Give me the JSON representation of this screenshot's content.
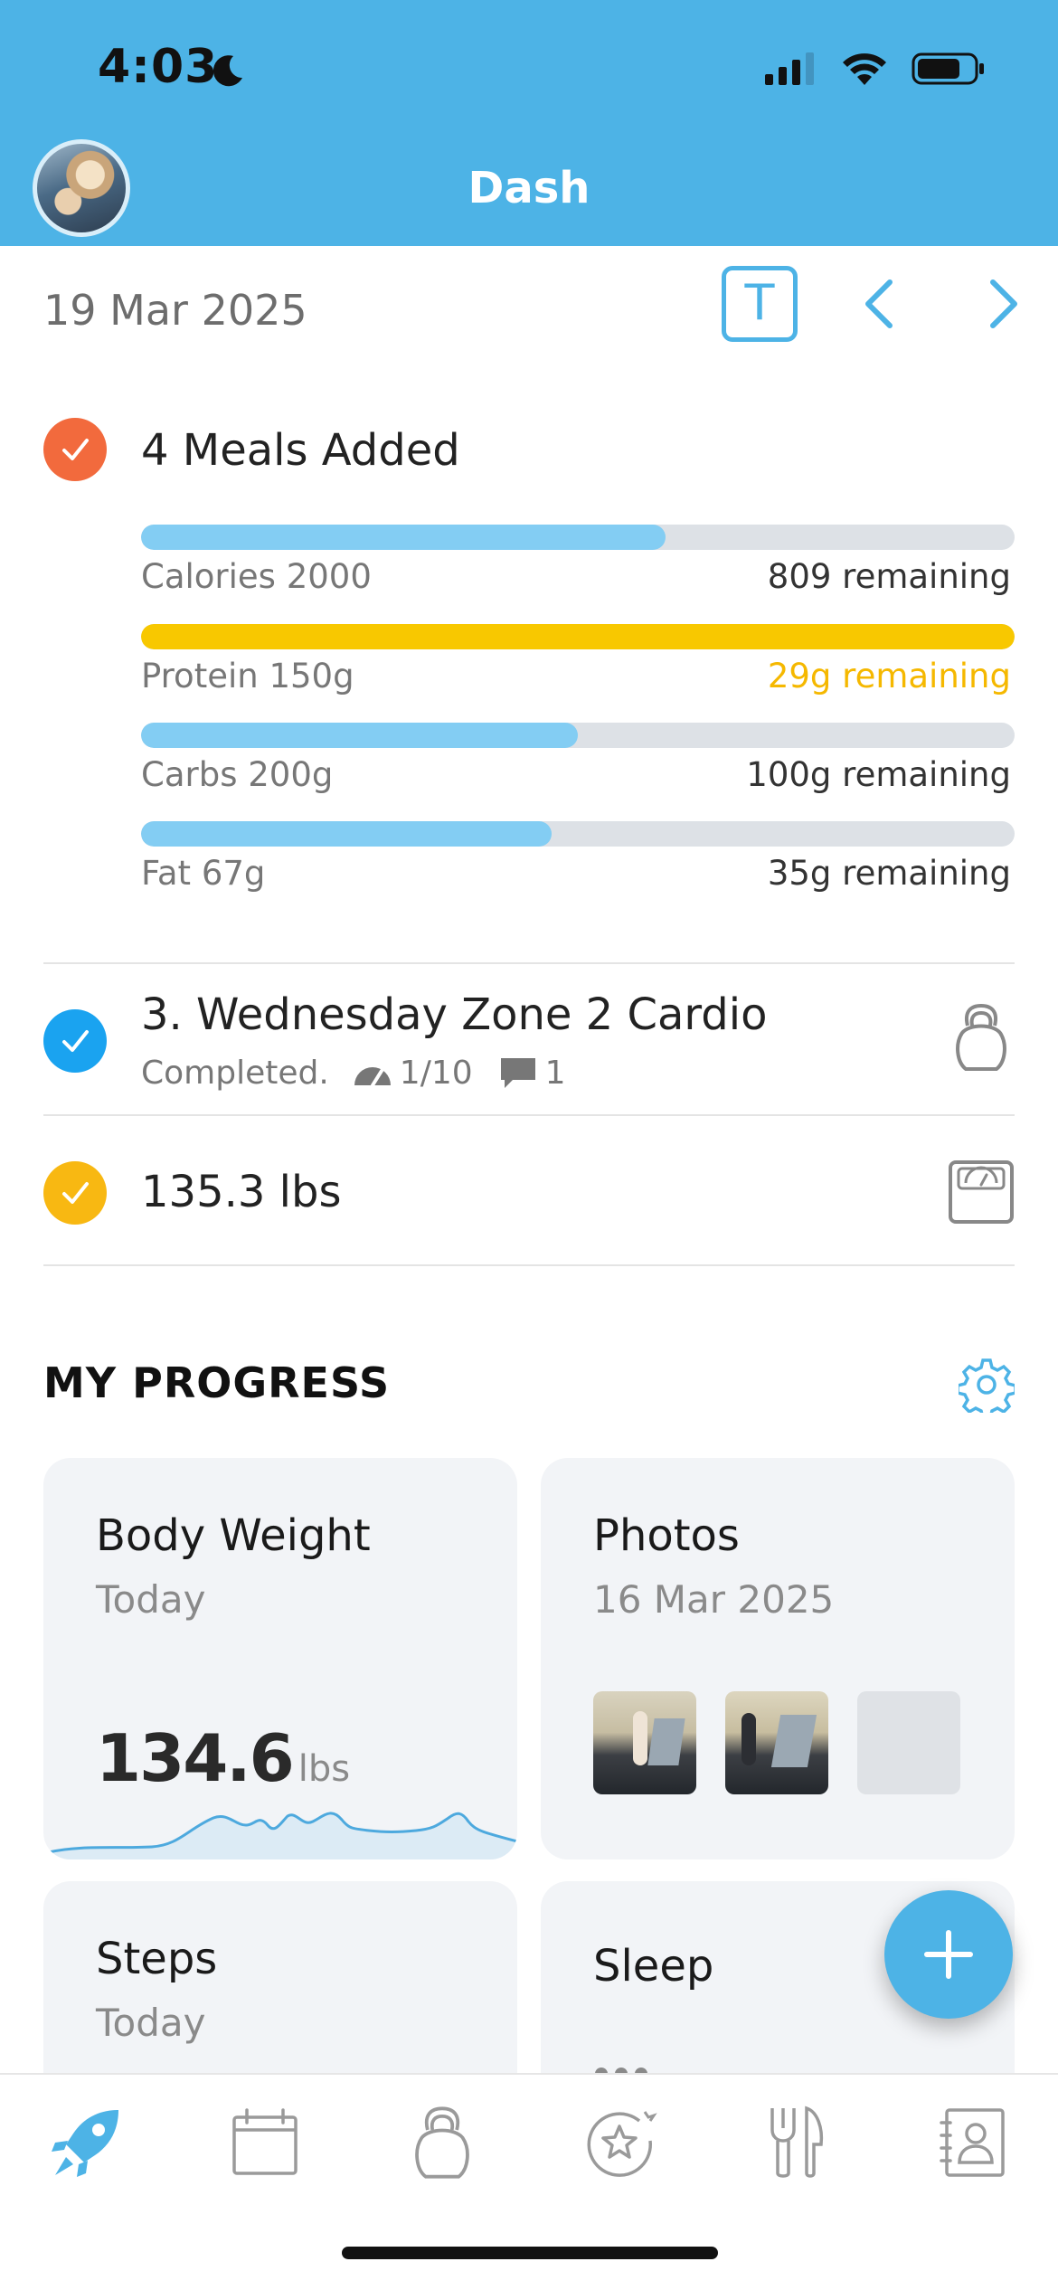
{
  "status_bar": {
    "time": "4:03"
  },
  "header": {
    "title": "Dash"
  },
  "date_nav": {
    "date": "19 Mar 2025",
    "today_label": "T"
  },
  "meals": {
    "title": "4 Meals Added",
    "macros": [
      {
        "label": "Calories 2000",
        "remaining": "809 remaining",
        "progress": 0.6,
        "fill_color": "#83cdf3",
        "remaining_color": "#333333"
      },
      {
        "label": "Protein 150g",
        "remaining": "29g remaining",
        "progress": 1.0,
        "fill_color": "#f8c800",
        "remaining_color": "#f5b800"
      },
      {
        "label": "Carbs 200g",
        "remaining": "100g remaining",
        "progress": 0.5,
        "fill_color": "#83cdf3",
        "remaining_color": "#333333"
      },
      {
        "label": "Fat 67g",
        "remaining": "35g remaining",
        "progress": 0.47,
        "fill_color": "#83cdf3",
        "remaining_color": "#333333"
      }
    ]
  },
  "workout": {
    "title": "3. Wednesday Zone 2 Cardio",
    "status": "Completed.",
    "rating": "1/10",
    "comments": "1"
  },
  "weigh_in": {
    "value": "135.3 lbs"
  },
  "progress": {
    "title": "MY PROGRESS",
    "cards": {
      "body_weight": {
        "title": "Body Weight",
        "subtitle": "Today",
        "value": "134.6",
        "unit": "lbs"
      },
      "photos": {
        "title": "Photos",
        "subtitle": "16 Mar 2025"
      },
      "steps": {
        "title": "Steps",
        "subtitle": "Today"
      },
      "sleep": {
        "title": "Sleep"
      }
    }
  },
  "colors": {
    "brand": "#4db3e6",
    "meals_check": "#f26a3d",
    "workout_check": "#1aa3f0",
    "weight_check": "#f8b812"
  },
  "tabs": [
    "rocket-icon",
    "calendar-icon",
    "kettlebell-icon",
    "star-badge-icon",
    "fork-knife-icon",
    "contacts-icon"
  ]
}
